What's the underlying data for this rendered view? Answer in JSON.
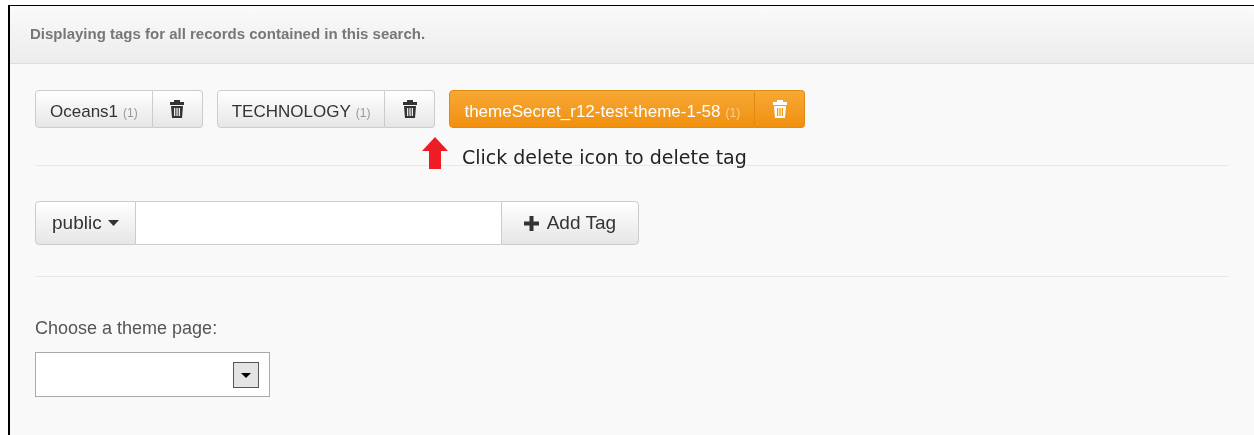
{
  "panel": {
    "heading": "Displaying tags for all records contained in this search."
  },
  "tags": [
    {
      "label": "Oceans1",
      "count": "(1)",
      "highlighted": false
    },
    {
      "label": "TECHNOLOGY",
      "count": "(1)",
      "highlighted": false
    },
    {
      "label": "themeSecret_r12-test-theme-1-58",
      "count": "(1)",
      "highlighted": true
    }
  ],
  "annotation": {
    "text": "Click delete icon to delete tag"
  },
  "add_tag": {
    "visibility": "public",
    "button": "Add Tag"
  },
  "theme_page": {
    "label": "Choose a theme page:"
  }
}
